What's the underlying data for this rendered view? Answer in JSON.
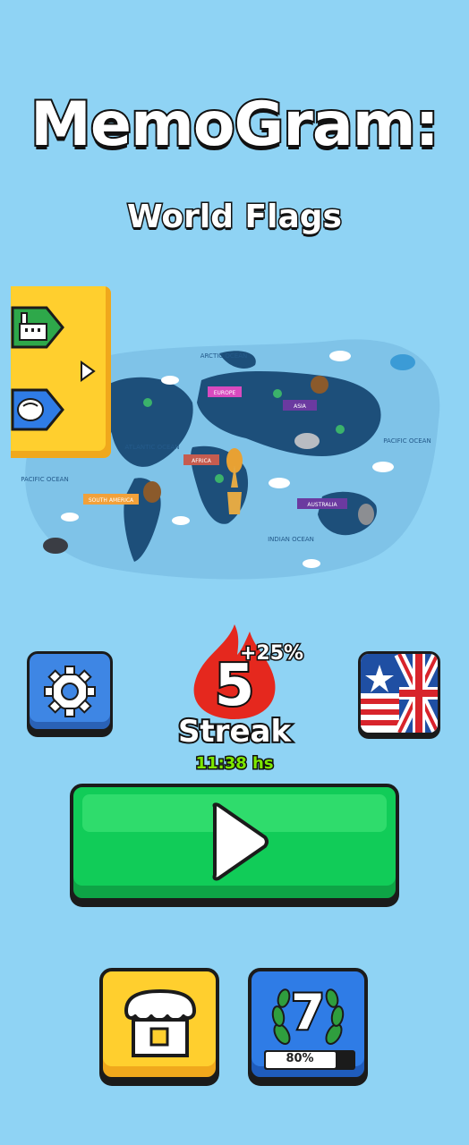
{
  "header": {
    "title": "MemoGram:",
    "subtitle": "World Flags"
  },
  "map": {
    "oceans": [
      "ARCTIC OCEAN",
      "ATLANTIC OCEAN",
      "PACIFIC OCEAN",
      "PACIFIC OCEAN",
      "INDIAN OCEAN"
    ],
    "continents": [
      "EUROPE",
      "ASIA",
      "AFRICA",
      "SOUTH AMERICA",
      "AUSTRALIA"
    ]
  },
  "side_panel": {
    "icons": [
      "industry-icon",
      "backpack-icon",
      "chevron-right-icon"
    ]
  },
  "streak": {
    "count": "5",
    "bonus": "+25%",
    "label": "Streak",
    "timer": "11:38 hs"
  },
  "level": {
    "number": "7",
    "progress": 0.8,
    "progress_label": "80%"
  },
  "colors": {
    "background": "#8fd3f4",
    "play": "#11cc58",
    "shop": "#ffcf2e",
    "level": "#2f7ce6",
    "streak_flame": "#e5281e",
    "timer": "#7de800"
  }
}
